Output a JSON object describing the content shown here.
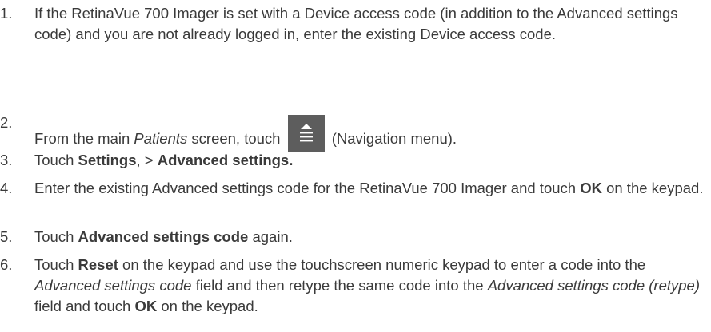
{
  "steps": [
    {
      "number": "1.",
      "text": "If the RetinaVue 700 Imager is set with a Device access code (in addition to the Advanced settings code) and you are not already logged in, enter the existing Device access code."
    },
    {
      "number": "2.",
      "before": "From the main ",
      "italic": "Patients",
      "middle": " screen, touch ",
      "icon": "navigation-menu-icon",
      "after": " (Navigation menu)."
    },
    {
      "number": "3.",
      "t1": "Touch ",
      "b1": "Settings",
      "t2": ", > ",
      "b2": "Advanced settings."
    },
    {
      "number": "4.",
      "t1": "Enter the existing Advanced settings code for the RetinaVue 700 Imager and touch ",
      "b1": "OK",
      "t2": " on the keypad."
    },
    {
      "number": "5.",
      "t1": "Touch ",
      "b1": "Advanced settings code",
      "t2": " again."
    },
    {
      "number": "6.",
      "t1": "Touch ",
      "b1": "Reset",
      "t2": " on the keypad and use the touchscreen numeric keypad to enter a code into the ",
      "i1": "Advanced settings code",
      "t3": " field and then retype the same code into the ",
      "i2": "Advanced settings code (retype)",
      "t4": " field and touch ",
      "b2": "OK",
      "t5": " on the keypad."
    }
  ]
}
